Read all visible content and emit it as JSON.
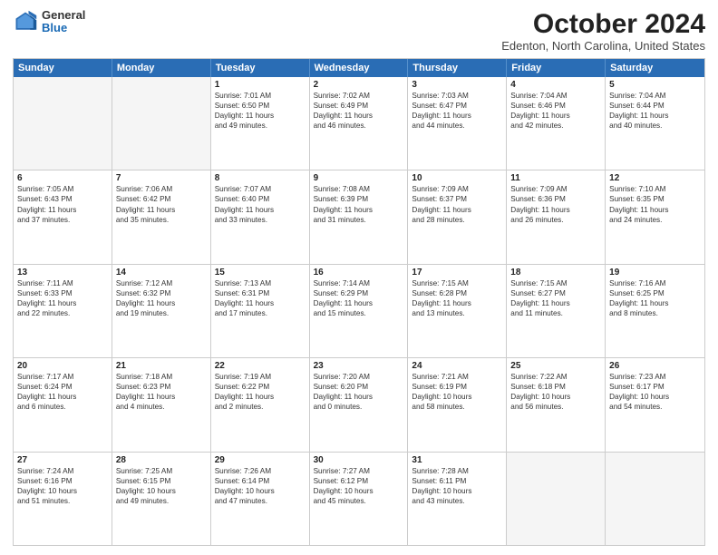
{
  "logo": {
    "general": "General",
    "blue": "Blue"
  },
  "title": "October 2024",
  "location": "Edenton, North Carolina, United States",
  "weekdays": [
    "Sunday",
    "Monday",
    "Tuesday",
    "Wednesday",
    "Thursday",
    "Friday",
    "Saturday"
  ],
  "weeks": [
    [
      {
        "day": "",
        "empty": true,
        "lines": []
      },
      {
        "day": "",
        "empty": true,
        "lines": []
      },
      {
        "day": "1",
        "empty": false,
        "lines": [
          "Sunrise: 7:01 AM",
          "Sunset: 6:50 PM",
          "Daylight: 11 hours",
          "and 49 minutes."
        ]
      },
      {
        "day": "2",
        "empty": false,
        "lines": [
          "Sunrise: 7:02 AM",
          "Sunset: 6:49 PM",
          "Daylight: 11 hours",
          "and 46 minutes."
        ]
      },
      {
        "day": "3",
        "empty": false,
        "lines": [
          "Sunrise: 7:03 AM",
          "Sunset: 6:47 PM",
          "Daylight: 11 hours",
          "and 44 minutes."
        ]
      },
      {
        "day": "4",
        "empty": false,
        "lines": [
          "Sunrise: 7:04 AM",
          "Sunset: 6:46 PM",
          "Daylight: 11 hours",
          "and 42 minutes."
        ]
      },
      {
        "day": "5",
        "empty": false,
        "lines": [
          "Sunrise: 7:04 AM",
          "Sunset: 6:44 PM",
          "Daylight: 11 hours",
          "and 40 minutes."
        ]
      }
    ],
    [
      {
        "day": "6",
        "empty": false,
        "lines": [
          "Sunrise: 7:05 AM",
          "Sunset: 6:43 PM",
          "Daylight: 11 hours",
          "and 37 minutes."
        ]
      },
      {
        "day": "7",
        "empty": false,
        "lines": [
          "Sunrise: 7:06 AM",
          "Sunset: 6:42 PM",
          "Daylight: 11 hours",
          "and 35 minutes."
        ]
      },
      {
        "day": "8",
        "empty": false,
        "lines": [
          "Sunrise: 7:07 AM",
          "Sunset: 6:40 PM",
          "Daylight: 11 hours",
          "and 33 minutes."
        ]
      },
      {
        "day": "9",
        "empty": false,
        "lines": [
          "Sunrise: 7:08 AM",
          "Sunset: 6:39 PM",
          "Daylight: 11 hours",
          "and 31 minutes."
        ]
      },
      {
        "day": "10",
        "empty": false,
        "lines": [
          "Sunrise: 7:09 AM",
          "Sunset: 6:37 PM",
          "Daylight: 11 hours",
          "and 28 minutes."
        ]
      },
      {
        "day": "11",
        "empty": false,
        "lines": [
          "Sunrise: 7:09 AM",
          "Sunset: 6:36 PM",
          "Daylight: 11 hours",
          "and 26 minutes."
        ]
      },
      {
        "day": "12",
        "empty": false,
        "lines": [
          "Sunrise: 7:10 AM",
          "Sunset: 6:35 PM",
          "Daylight: 11 hours",
          "and 24 minutes."
        ]
      }
    ],
    [
      {
        "day": "13",
        "empty": false,
        "lines": [
          "Sunrise: 7:11 AM",
          "Sunset: 6:33 PM",
          "Daylight: 11 hours",
          "and 22 minutes."
        ]
      },
      {
        "day": "14",
        "empty": false,
        "lines": [
          "Sunrise: 7:12 AM",
          "Sunset: 6:32 PM",
          "Daylight: 11 hours",
          "and 19 minutes."
        ]
      },
      {
        "day": "15",
        "empty": false,
        "lines": [
          "Sunrise: 7:13 AM",
          "Sunset: 6:31 PM",
          "Daylight: 11 hours",
          "and 17 minutes."
        ]
      },
      {
        "day": "16",
        "empty": false,
        "lines": [
          "Sunrise: 7:14 AM",
          "Sunset: 6:29 PM",
          "Daylight: 11 hours",
          "and 15 minutes."
        ]
      },
      {
        "day": "17",
        "empty": false,
        "lines": [
          "Sunrise: 7:15 AM",
          "Sunset: 6:28 PM",
          "Daylight: 11 hours",
          "and 13 minutes."
        ]
      },
      {
        "day": "18",
        "empty": false,
        "lines": [
          "Sunrise: 7:15 AM",
          "Sunset: 6:27 PM",
          "Daylight: 11 hours",
          "and 11 minutes."
        ]
      },
      {
        "day": "19",
        "empty": false,
        "lines": [
          "Sunrise: 7:16 AM",
          "Sunset: 6:25 PM",
          "Daylight: 11 hours",
          "and 8 minutes."
        ]
      }
    ],
    [
      {
        "day": "20",
        "empty": false,
        "lines": [
          "Sunrise: 7:17 AM",
          "Sunset: 6:24 PM",
          "Daylight: 11 hours",
          "and 6 minutes."
        ]
      },
      {
        "day": "21",
        "empty": false,
        "lines": [
          "Sunrise: 7:18 AM",
          "Sunset: 6:23 PM",
          "Daylight: 11 hours",
          "and 4 minutes."
        ]
      },
      {
        "day": "22",
        "empty": false,
        "lines": [
          "Sunrise: 7:19 AM",
          "Sunset: 6:22 PM",
          "Daylight: 11 hours",
          "and 2 minutes."
        ]
      },
      {
        "day": "23",
        "empty": false,
        "lines": [
          "Sunrise: 7:20 AM",
          "Sunset: 6:20 PM",
          "Daylight: 11 hours",
          "and 0 minutes."
        ]
      },
      {
        "day": "24",
        "empty": false,
        "lines": [
          "Sunrise: 7:21 AM",
          "Sunset: 6:19 PM",
          "Daylight: 10 hours",
          "and 58 minutes."
        ]
      },
      {
        "day": "25",
        "empty": false,
        "lines": [
          "Sunrise: 7:22 AM",
          "Sunset: 6:18 PM",
          "Daylight: 10 hours",
          "and 56 minutes."
        ]
      },
      {
        "day": "26",
        "empty": false,
        "lines": [
          "Sunrise: 7:23 AM",
          "Sunset: 6:17 PM",
          "Daylight: 10 hours",
          "and 54 minutes."
        ]
      }
    ],
    [
      {
        "day": "27",
        "empty": false,
        "lines": [
          "Sunrise: 7:24 AM",
          "Sunset: 6:16 PM",
          "Daylight: 10 hours",
          "and 51 minutes."
        ]
      },
      {
        "day": "28",
        "empty": false,
        "lines": [
          "Sunrise: 7:25 AM",
          "Sunset: 6:15 PM",
          "Daylight: 10 hours",
          "and 49 minutes."
        ]
      },
      {
        "day": "29",
        "empty": false,
        "lines": [
          "Sunrise: 7:26 AM",
          "Sunset: 6:14 PM",
          "Daylight: 10 hours",
          "and 47 minutes."
        ]
      },
      {
        "day": "30",
        "empty": false,
        "lines": [
          "Sunrise: 7:27 AM",
          "Sunset: 6:12 PM",
          "Daylight: 10 hours",
          "and 45 minutes."
        ]
      },
      {
        "day": "31",
        "empty": false,
        "lines": [
          "Sunrise: 7:28 AM",
          "Sunset: 6:11 PM",
          "Daylight: 10 hours",
          "and 43 minutes."
        ]
      },
      {
        "day": "",
        "empty": true,
        "lines": []
      },
      {
        "day": "",
        "empty": true,
        "lines": []
      }
    ]
  ]
}
